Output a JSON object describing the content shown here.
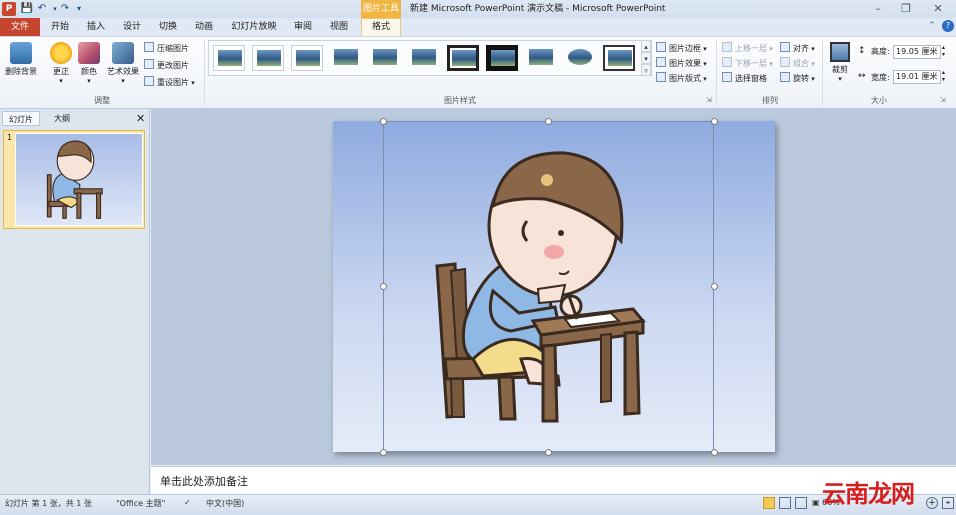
{
  "app": {
    "icon_letter": "P",
    "window_title": "新建 Microsoft PowerPoint 演示文稿  -  Microsoft PowerPoint",
    "context_tools": "图片工具"
  },
  "tabs": {
    "file": "文件",
    "items": [
      "开始",
      "插入",
      "设计",
      "切换",
      "动画",
      "幻灯片放映",
      "审阅",
      "视图"
    ],
    "format": "格式"
  },
  "ribbon": {
    "adjust": {
      "remove_bg": "删除背景",
      "corrections": "更正",
      "color": "颜色",
      "artistic": "艺术效果",
      "compress": "压缩图片",
      "change": "更改图片",
      "reset": "重设图片",
      "label": "调整"
    },
    "styles": {
      "label": "图片样式",
      "border": "图片边框",
      "effects": "图片效果",
      "layout": "图片版式"
    },
    "arrange": {
      "label": "排列",
      "bring_forward": "上移一层",
      "send_backward": "下移一层",
      "selection_pane": "选择窗格",
      "align": "对齐",
      "group": "组合",
      "rotate": "旋转"
    },
    "size": {
      "label": "大小",
      "crop": "裁剪",
      "height_label": "高度:",
      "height_value": "19.05 厘米",
      "width_label": "宽度:",
      "width_value": "19.01 厘米"
    }
  },
  "panel": {
    "tab_slides": "幻灯片",
    "tab_outline": "大纲",
    "slide_number": "1"
  },
  "notes": {
    "placeholder": "单击此处添加备注"
  },
  "status": {
    "slide_info": "幻灯片 第 1 张，共 1 张",
    "theme": "\"Office 主题\"",
    "language": "中文(中国)",
    "zoom": "66%"
  },
  "watermark": "云南龙网"
}
